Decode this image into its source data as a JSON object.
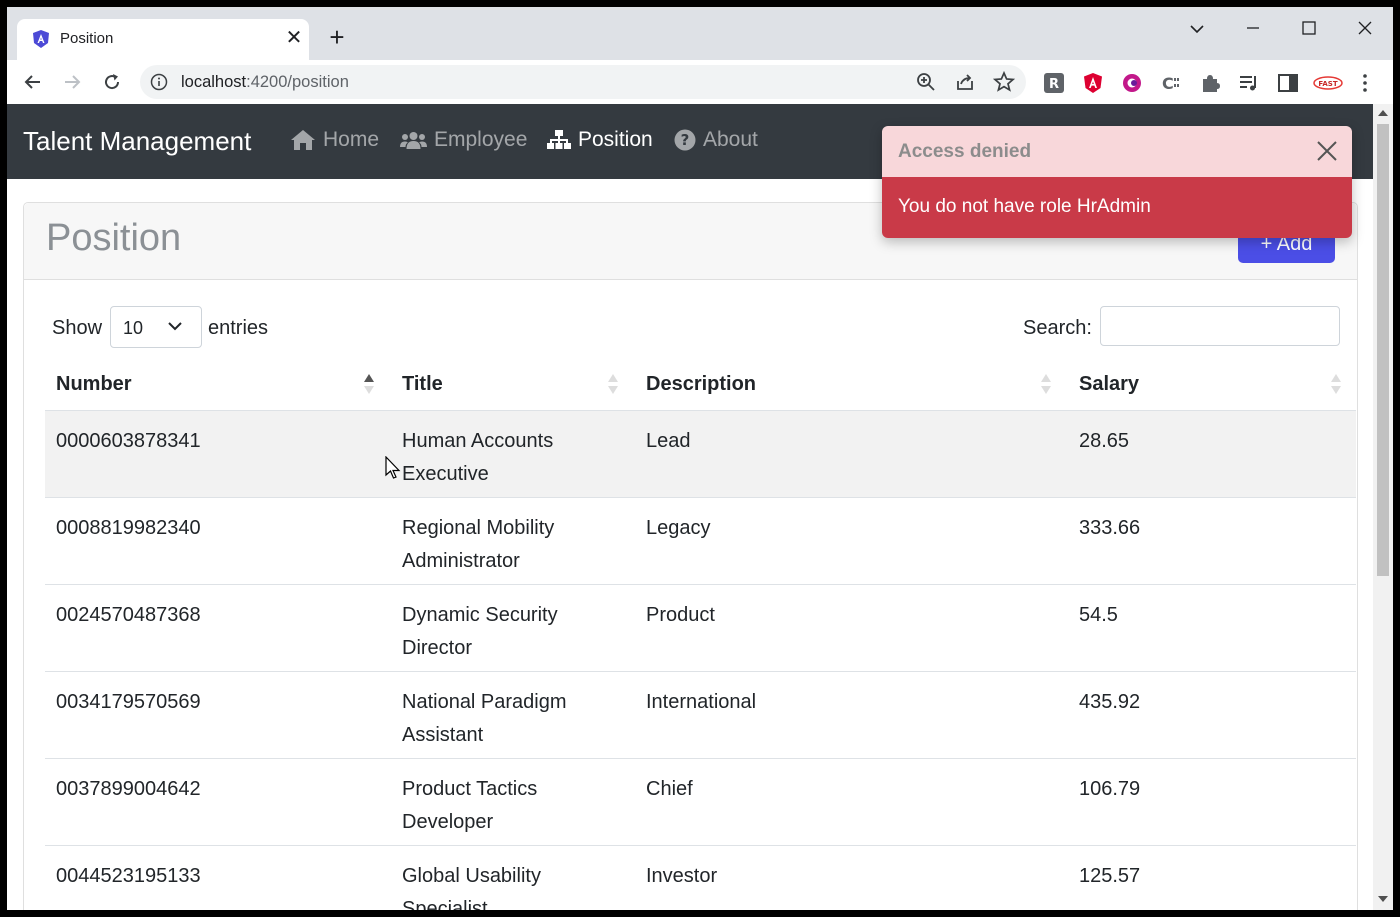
{
  "browser": {
    "tab_title": "Position",
    "url_host": "localhost",
    "url_path": ":4200/position"
  },
  "app": {
    "brand": "Talent Management",
    "nav": [
      {
        "label": "Home",
        "icon": "home-icon"
      },
      {
        "label": "Employee",
        "icon": "users-icon"
      },
      {
        "label": "Position",
        "icon": "sitemap-icon"
      },
      {
        "label": "About",
        "icon": "question-circle-icon"
      }
    ],
    "active_nav": "Position"
  },
  "card": {
    "title": "Position",
    "add_label": "+ Add"
  },
  "table_controls": {
    "show_label": "Show",
    "page_length": "10",
    "entries_label": "entries",
    "search_label": "Search:",
    "search_value": ""
  },
  "table": {
    "columns": [
      "Number",
      "Title",
      "Description",
      "Salary"
    ],
    "sorted_column": "Number",
    "sort_direction": "ascending",
    "rows": [
      {
        "number": "0000603878341",
        "title_1": "Human Accounts",
        "title_2": "Executive",
        "description": "Lead",
        "salary": "28.65"
      },
      {
        "number": "0008819982340",
        "title_1": "Regional Mobility",
        "title_2": "Administrator",
        "description": "Legacy",
        "salary": "333.66"
      },
      {
        "number": "0024570487368",
        "title_1": "Dynamic Security",
        "title_2": "Director",
        "description": "Product",
        "salary": "54.5"
      },
      {
        "number": "0034179570569",
        "title_1": "National Paradigm",
        "title_2": "Assistant",
        "description": "International",
        "salary": "435.92"
      },
      {
        "number": "0037899004642",
        "title_1": "Product Tactics",
        "title_2": "Developer",
        "description": "Chief",
        "salary": "106.79"
      },
      {
        "number": "0044523195133",
        "title_1": "Global Usability",
        "title_2": "Specialist",
        "description": "Investor",
        "salary": "125.57"
      }
    ]
  },
  "toast": {
    "title": "Access denied",
    "message": "You do not have role HrAdmin"
  },
  "colors": {
    "navbar": "#343a40",
    "add_button": "#4b4ee6",
    "toast_header": "#f8d7da",
    "toast_body": "#c93a48"
  }
}
